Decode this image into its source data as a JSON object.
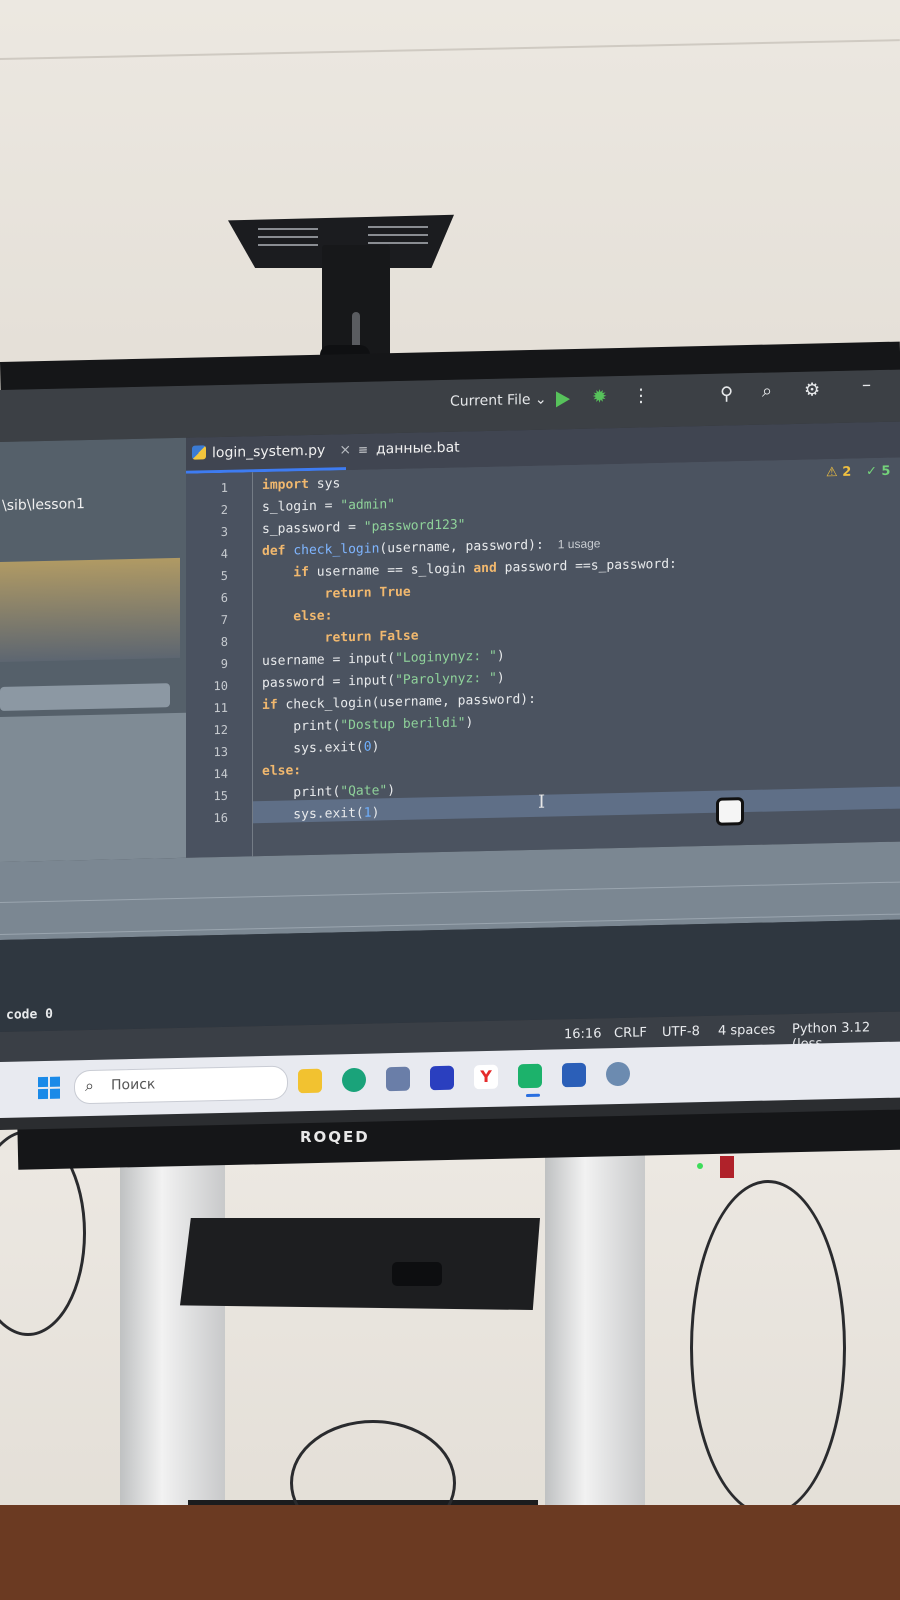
{
  "toolbar": {
    "run_config": "Current File",
    "run_config_caret": "⌄",
    "run_icon": "play-icon",
    "debug_icon": "bug-icon",
    "more_icon": "vertical-dots-icon",
    "add_user_icon": "add-user-icon",
    "search_icon": "search-icon",
    "settings_icon": "gear-icon",
    "minimize_label": "–"
  },
  "project": {
    "path": "\\sib\\lesson1"
  },
  "tabs": [
    {
      "label": "login_system.py",
      "icon": "python-file-icon",
      "close": "×"
    },
    {
      "label": "данные.bat",
      "icon": "text-file-icon"
    }
  ],
  "inspections": {
    "warnings": "2",
    "ok": "5"
  },
  "editor": {
    "line_numbers": [
      "1",
      "2",
      "3",
      "4",
      "5",
      "6",
      "7",
      "8",
      "9",
      "10",
      "11",
      "12",
      "13",
      "14",
      "15",
      "16"
    ],
    "lines": {
      "l1a": "import",
      "l1b": " sys",
      "l2a": "s_login = ",
      "l2b": "\"admin\"",
      "l3a": "s_password = ",
      "l3b": "\"password123\"",
      "l4a": "def ",
      "l4b": "check_login",
      "l4c": "(username, password):",
      "l4hint": "1 usage",
      "l5a": "    if",
      "l5b": " username == s_login ",
      "l5c": "and",
      "l5d": " password ==s_password:",
      "l6a": "        return ",
      "l6b": "True",
      "l7a": "    else:",
      "l8a": "        return ",
      "l8b": "False",
      "l9a": "username = input(",
      "l9b": "\"Loginynyz: \"",
      "l9c": ")",
      "l10a": "password = input(",
      "l10b": "\"Parolynyz: \"",
      "l10c": ")",
      "l11a": "if",
      "l11b": " check_login(username, password):",
      "l12a": "    print(",
      "l12b": "\"Dostup berildi\"",
      "l12c": ")",
      "l13a": "    sys.exit(",
      "l13b": "0",
      "l13c": ")",
      "l14a": "else:",
      "l15a": "    print(",
      "l15b": "\"Qate\"",
      "l15c": ")",
      "l16a": "    sys.exit(",
      "l16b": "1",
      "l16c": ")"
    }
  },
  "terminal": {
    "text": "code 0"
  },
  "statusbar": {
    "position": "16:16",
    "line_sep": "CRLF",
    "encoding": "UTF-8",
    "indent": "4 spaces",
    "interpreter": "Python 3.12 (less"
  },
  "taskbar": {
    "search_placeholder": "Поиск",
    "apps": [
      "file-explorer-icon",
      "edge-icon",
      "app-cube-icon",
      "jetbrains-toolbox-icon",
      "yandex-browser-icon",
      "pycharm-icon",
      "word-icon",
      "settings-icon"
    ]
  },
  "monitor": {
    "brand": "ROQED"
  },
  "colors": {
    "editor_bg": "#4b5360",
    "keyword": "#f1b86e",
    "string": "#8fd29a",
    "function": "#7fb5ff",
    "accent": "#3e7cf2",
    "warning": "#f0c040",
    "ok": "#74d27a"
  }
}
